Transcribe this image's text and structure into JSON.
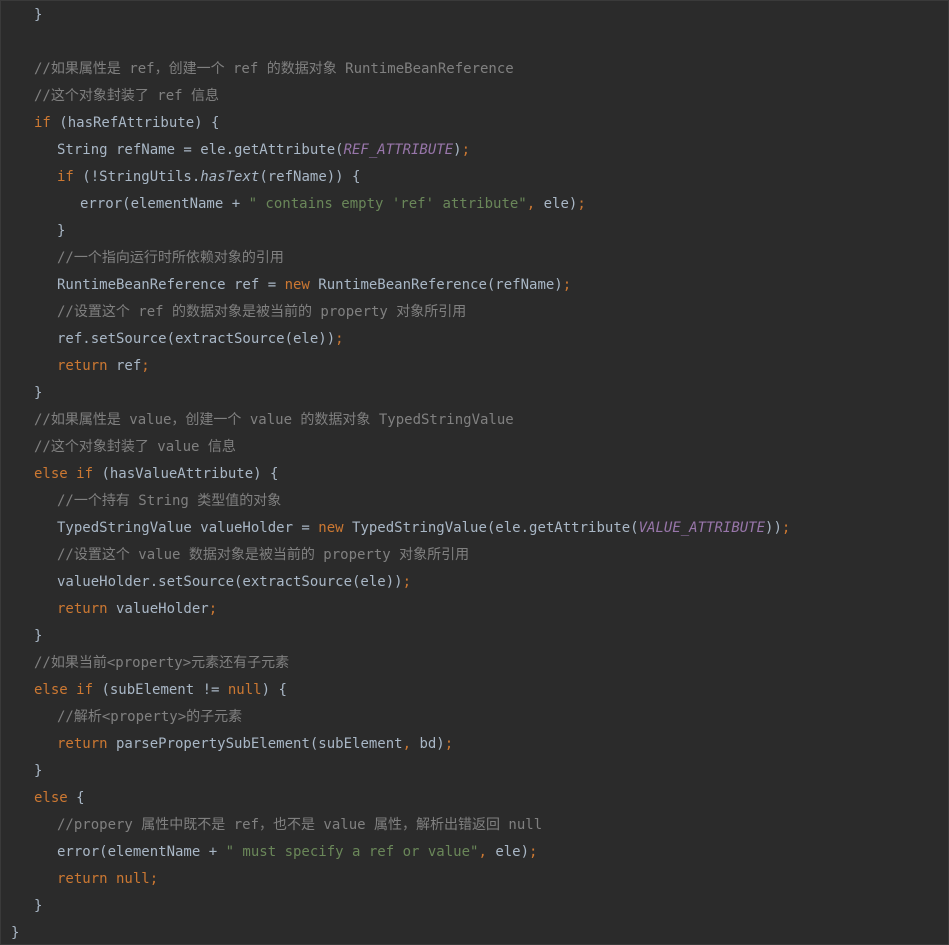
{
  "editor": {
    "lines": [
      {
        "indent": 1,
        "tokens": [
          {
            "t": "}",
            "c": "id"
          }
        ]
      },
      {
        "indent": 0,
        "tokens": []
      },
      {
        "indent": 1,
        "tokens": [
          {
            "t": "//如果属性是 ref，创建一个 ref 的数据对象 RuntimeBeanReference",
            "c": "cmt"
          }
        ]
      },
      {
        "indent": 1,
        "tokens": [
          {
            "t": "//这个对象封装了 ref 信息",
            "c": "cmt"
          }
        ]
      },
      {
        "indent": 1,
        "tokens": [
          {
            "t": "if",
            "c": "kw"
          },
          {
            "t": " (hasRefAttribute) {",
            "c": "id"
          }
        ]
      },
      {
        "indent": 2,
        "tokens": [
          {
            "t": "String refName = ele.getAttribute(",
            "c": "id"
          },
          {
            "t": "REF_ATTRIBUTE",
            "c": "const"
          },
          {
            "t": ")",
            "c": "id"
          },
          {
            "t": ";",
            "c": "kw"
          }
        ]
      },
      {
        "indent": 2,
        "tokens": [
          {
            "t": "if",
            "c": "kw"
          },
          {
            "t": " (!StringUtils.",
            "c": "id"
          },
          {
            "t": "hasText",
            "c": "ital"
          },
          {
            "t": "(refName)) {",
            "c": "id"
          }
        ]
      },
      {
        "indent": 3,
        "tokens": [
          {
            "t": "error(elementName + ",
            "c": "id"
          },
          {
            "t": "\" contains empty 'ref' attribute\"",
            "c": "str"
          },
          {
            "t": ", ",
            "c": "kw"
          },
          {
            "t": "ele)",
            "c": "id"
          },
          {
            "t": ";",
            "c": "kw"
          }
        ]
      },
      {
        "indent": 2,
        "tokens": [
          {
            "t": "}",
            "c": "id"
          }
        ]
      },
      {
        "indent": 2,
        "tokens": [
          {
            "t": "//一个指向运行时所依赖对象的引用",
            "c": "cmt"
          }
        ]
      },
      {
        "indent": 2,
        "tokens": [
          {
            "t": "RuntimeBeanReference ref = ",
            "c": "id"
          },
          {
            "t": "new",
            "c": "kw"
          },
          {
            "t": " RuntimeBeanReference(refName)",
            "c": "id"
          },
          {
            "t": ";",
            "c": "kw"
          }
        ]
      },
      {
        "indent": 2,
        "tokens": [
          {
            "t": "//设置这个 ref 的数据对象是被当前的 property 对象所引用",
            "c": "cmt"
          }
        ]
      },
      {
        "indent": 2,
        "tokens": [
          {
            "t": "ref.setSource(extractSource(ele))",
            "c": "id"
          },
          {
            "t": ";",
            "c": "kw"
          }
        ]
      },
      {
        "indent": 2,
        "tokens": [
          {
            "t": "return",
            "c": "kw"
          },
          {
            "t": " ref",
            "c": "id"
          },
          {
            "t": ";",
            "c": "kw"
          }
        ]
      },
      {
        "indent": 1,
        "tokens": [
          {
            "t": "}",
            "c": "id"
          }
        ]
      },
      {
        "indent": 1,
        "tokens": [
          {
            "t": "//如果属性是 value，创建一个 value 的数据对象 TypedStringValue",
            "c": "cmt"
          }
        ]
      },
      {
        "indent": 1,
        "tokens": [
          {
            "t": "//这个对象封装了 value 信息",
            "c": "cmt"
          }
        ]
      },
      {
        "indent": 1,
        "tokens": [
          {
            "t": "else if",
            "c": "kw"
          },
          {
            "t": " (hasValueAttribute) {",
            "c": "id"
          }
        ]
      },
      {
        "indent": 2,
        "tokens": [
          {
            "t": "//一个持有 String 类型值的对象",
            "c": "cmt"
          }
        ]
      },
      {
        "indent": 2,
        "tokens": [
          {
            "t": "TypedStringValue valueHolder = ",
            "c": "id"
          },
          {
            "t": "new",
            "c": "kw"
          },
          {
            "t": " TypedStringValue(ele.getAttribute(",
            "c": "id"
          },
          {
            "t": "VALUE_ATTRIBUTE",
            "c": "const"
          },
          {
            "t": "))",
            "c": "id"
          },
          {
            "t": ";",
            "c": "kw"
          }
        ]
      },
      {
        "indent": 2,
        "tokens": [
          {
            "t": "//设置这个 value 数据对象是被当前的 property 对象所引用",
            "c": "cmt"
          }
        ]
      },
      {
        "indent": 2,
        "tokens": [
          {
            "t": "valueHolder.setSource(extractSource(ele))",
            "c": "id"
          },
          {
            "t": ";",
            "c": "kw"
          }
        ]
      },
      {
        "indent": 2,
        "tokens": [
          {
            "t": "return",
            "c": "kw"
          },
          {
            "t": " valueHolder",
            "c": "id"
          },
          {
            "t": ";",
            "c": "kw"
          }
        ]
      },
      {
        "indent": 1,
        "tokens": [
          {
            "t": "}",
            "c": "id"
          }
        ]
      },
      {
        "indent": 1,
        "tokens": [
          {
            "t": "//如果当前<property>元素还有子元素",
            "c": "cmt"
          }
        ]
      },
      {
        "indent": 1,
        "tokens": [
          {
            "t": "else if",
            "c": "kw"
          },
          {
            "t": " (subElement != ",
            "c": "id"
          },
          {
            "t": "null",
            "c": "kw"
          },
          {
            "t": ") {",
            "c": "id"
          }
        ]
      },
      {
        "indent": 2,
        "tokens": [
          {
            "t": "//解析<property>的子元素",
            "c": "cmt"
          }
        ]
      },
      {
        "indent": 2,
        "tokens": [
          {
            "t": "return",
            "c": "kw"
          },
          {
            "t": " parsePropertySubElement(subElement",
            "c": "id"
          },
          {
            "t": ", ",
            "c": "kw"
          },
          {
            "t": "bd)",
            "c": "id"
          },
          {
            "t": ";",
            "c": "kw"
          }
        ]
      },
      {
        "indent": 1,
        "tokens": [
          {
            "t": "}",
            "c": "id"
          }
        ]
      },
      {
        "indent": 1,
        "tokens": [
          {
            "t": "else",
            "c": "kw"
          },
          {
            "t": " {",
            "c": "id"
          }
        ]
      },
      {
        "indent": 2,
        "tokens": [
          {
            "t": "//propery 属性中既不是 ref，也不是 value 属性，解析出错返回 null",
            "c": "cmt"
          }
        ]
      },
      {
        "indent": 2,
        "tokens": [
          {
            "t": "error(elementName + ",
            "c": "id"
          },
          {
            "t": "\" must specify a ref or value\"",
            "c": "str"
          },
          {
            "t": ", ",
            "c": "kw"
          },
          {
            "t": "ele)",
            "c": "id"
          },
          {
            "t": ";",
            "c": "kw"
          }
        ]
      },
      {
        "indent": 2,
        "tokens": [
          {
            "t": "return null",
            "c": "kw"
          },
          {
            "t": ";",
            "c": "kw"
          }
        ]
      },
      {
        "indent": 1,
        "tokens": [
          {
            "t": "}",
            "c": "id"
          }
        ]
      },
      {
        "indent": 0,
        "tokens": [
          {
            "t": "}",
            "c": "id"
          }
        ]
      }
    ]
  },
  "colors": {
    "background": "#2b2b2b",
    "text": "#a9b7c6",
    "keyword": "#cc7832",
    "string": "#6a8759",
    "comment": "#808080",
    "constant": "#9876aa"
  }
}
